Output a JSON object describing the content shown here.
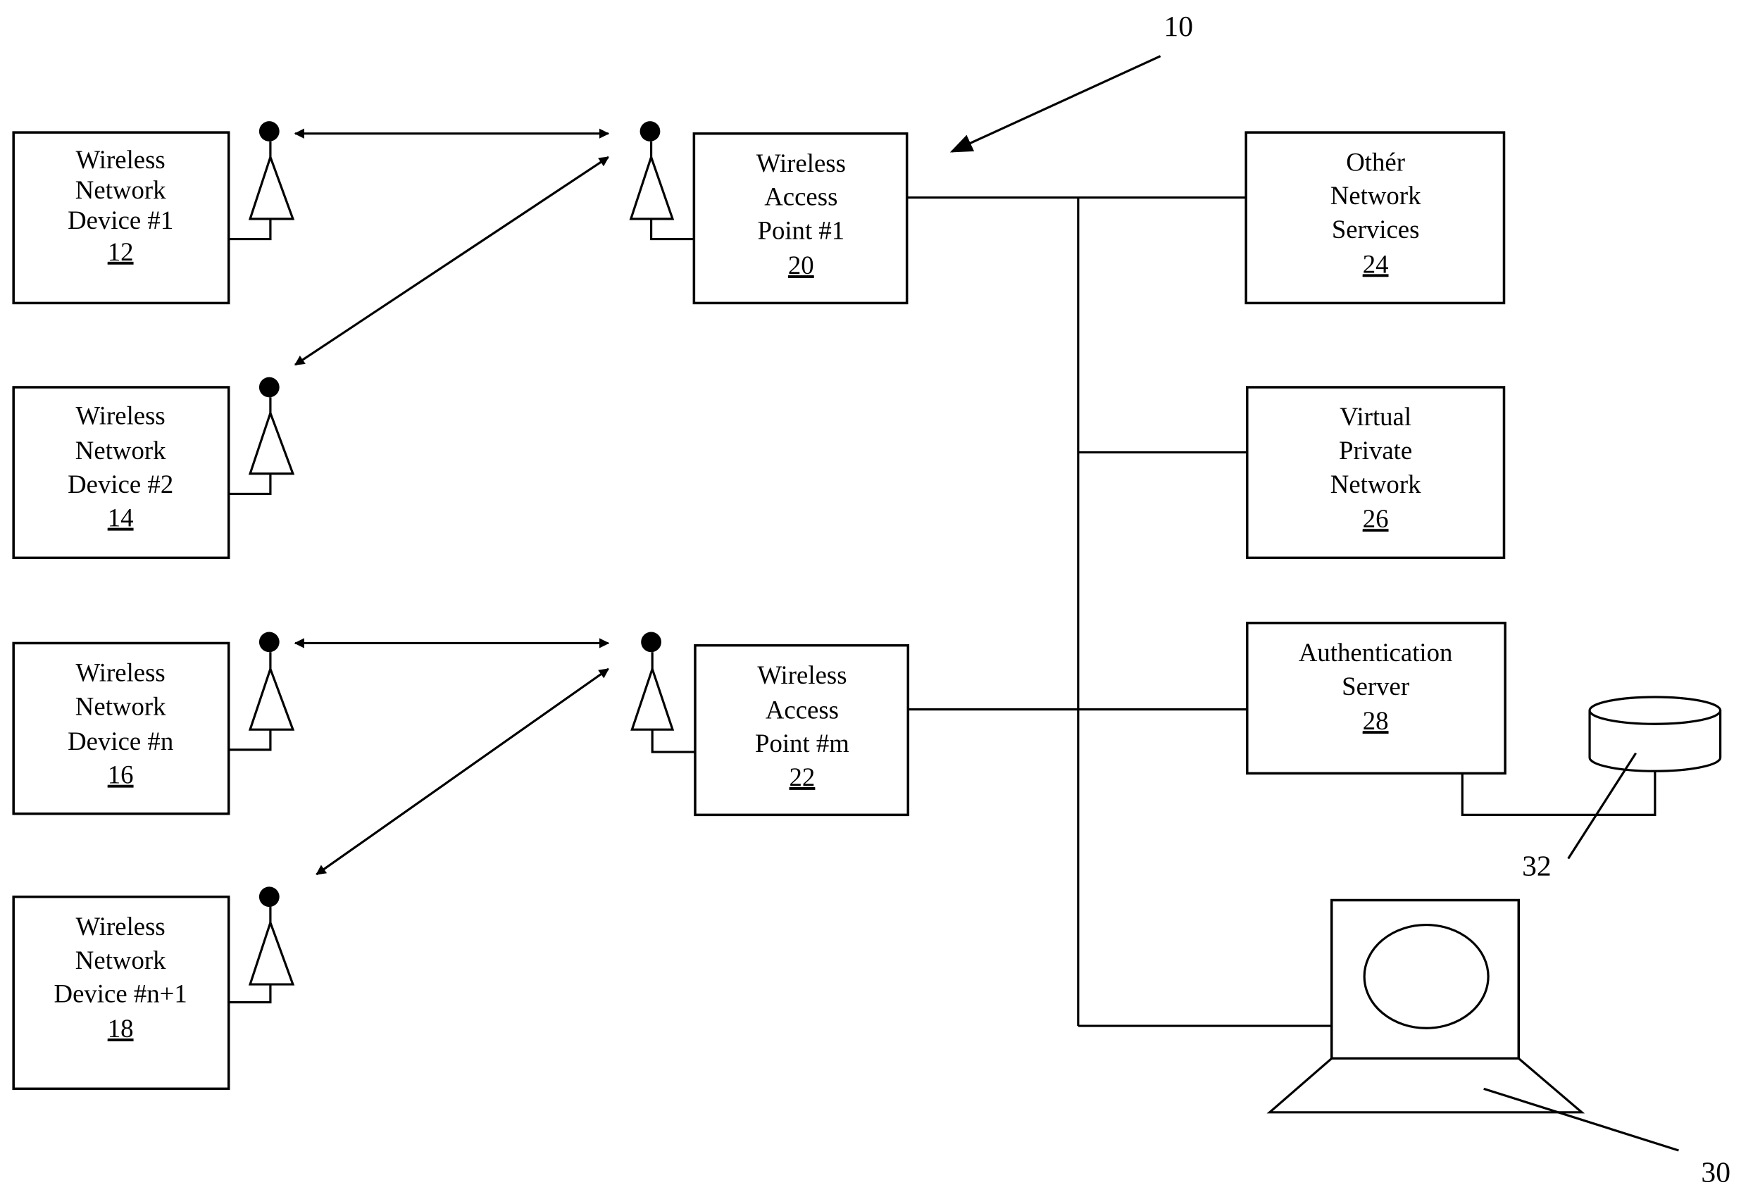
{
  "figure": {
    "reference_numeral": "10",
    "colors": {
      "ink": "#000000",
      "background": "#ffffff"
    }
  },
  "devices": [
    {
      "lines": [
        "Wireless",
        "Network",
        "Device #1"
      ],
      "ref": "12"
    },
    {
      "lines": [
        "Wireless",
        "Network",
        "Device #2"
      ],
      "ref": "14"
    },
    {
      "lines": [
        "Wireless",
        "Network",
        "Device #n"
      ],
      "ref": "16"
    },
    {
      "lines": [
        "Wireless",
        "Network",
        "Device #n+1"
      ],
      "ref": "18"
    }
  ],
  "access_points": [
    {
      "lines": [
        "Wireless",
        "Access",
        "Point #1"
      ],
      "ref": "20"
    },
    {
      "lines": [
        "Wireless",
        "Access",
        "Point #m"
      ],
      "ref": "22"
    }
  ],
  "services": [
    {
      "lines": [
        "Othér",
        "Network",
        "Services"
      ],
      "ref": "24"
    },
    {
      "lines": [
        "Virtual",
        "Private",
        "Network"
      ],
      "ref": "26"
    },
    {
      "lines": [
        "Authentication",
        "Server"
      ],
      "ref": "28"
    }
  ],
  "database": {
    "icon": "database-cylinder-icon",
    "ref": "32"
  },
  "computer": {
    "icon": "computer-terminal-icon",
    "ref": "30"
  },
  "links": [
    {
      "from": "Wireless Network Device #1",
      "to": "Wireless Access Point #1",
      "type": "wireless-bidirectional"
    },
    {
      "from": "Wireless Network Device #2",
      "to": "Wireless Access Point #1",
      "type": "wireless-bidirectional"
    },
    {
      "from": "Wireless Network Device #n",
      "to": "Wireless Access Point #m",
      "type": "wireless-bidirectional"
    },
    {
      "from": "Wireless Network Device #n+1",
      "to": "Wireless Access Point #m",
      "type": "wireless-bidirectional"
    }
  ]
}
